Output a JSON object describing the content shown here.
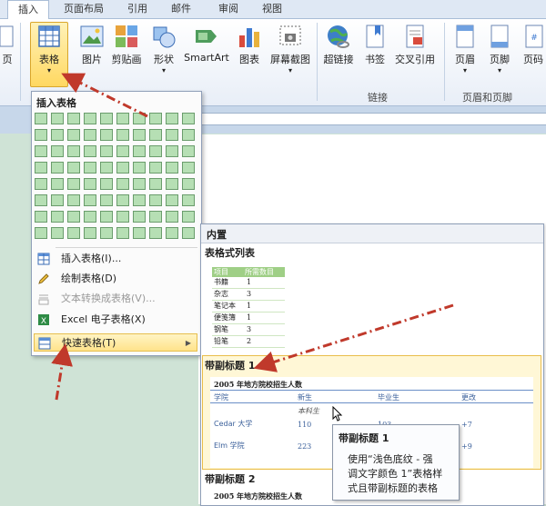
{
  "tabs": [
    "插入",
    "页面布局",
    "引用",
    "邮件",
    "审阅",
    "视图"
  ],
  "ribbon": {
    "left_cut": "页",
    "table": "表格",
    "picture": "图片",
    "clipart": "剪贴画",
    "shapes": "形状",
    "smartart": "SmartArt",
    "chart": "图表",
    "screenshot": "屏幕截图",
    "hyperlink": "超链接",
    "bookmark": "书签",
    "crossref": "交叉引用",
    "header": "页眉",
    "footer": "页脚",
    "pagenum_cut": "页码",
    "group_links": "链接",
    "group_header_footer": "页眉和页脚"
  },
  "insert_table_panel": {
    "title": "插入表格",
    "menu": [
      {
        "label": "插入表格(I)...",
        "enabled": true
      },
      {
        "label": "绘制表格(D)",
        "enabled": true
      },
      {
        "label": "文本转换成表格(V)...",
        "enabled": false
      },
      {
        "label": "Excel 电子表格(X)",
        "enabled": true
      },
      {
        "label": "快速表格(T)",
        "enabled": true,
        "highlighted": true
      }
    ]
  },
  "gallery": {
    "header": "内置",
    "section1": "表格式列表",
    "list_header": [
      "项目",
      "所需数目"
    ],
    "list_rows": [
      [
        "书籍",
        "1"
      ],
      [
        "杂志",
        "3"
      ],
      [
        "笔记本",
        "1"
      ],
      [
        "便笺簿",
        "1"
      ],
      [
        "钢笔",
        "3"
      ],
      [
        "铅笔",
        "2"
      ]
    ],
    "section2": "带副标题 1",
    "t2_title": "2005 年地方院校招生人数",
    "t2_cols": [
      "学院",
      "新生",
      "毕业生",
      "更改"
    ],
    "t2_sub": "本科生",
    "t2_rows": [
      [
        "Cedar 大学",
        "110",
        "103",
        "+7"
      ],
      [
        "Elm 学院",
        "223",
        "214",
        "+9"
      ]
    ],
    "section3": "带副标题 2",
    "t3_title": "2005 年地方院校招生人数"
  },
  "tooltip": {
    "title": "带副标题 1",
    "body": [
      "使用“浅色底纹 - 强",
      "调文字颜色 1”表格样",
      "式且带副标题的表格"
    ]
  }
}
